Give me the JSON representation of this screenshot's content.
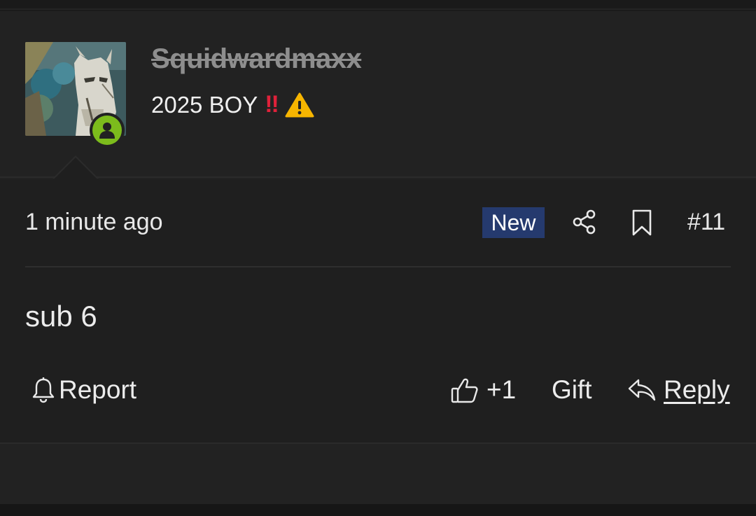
{
  "post": {
    "username": "Squidwardmaxx",
    "user_title": "2025 BOY",
    "user_title_emojis": [
      "double-exclamation",
      "warning-sign"
    ],
    "avatar": "horse-avatar",
    "online_status": "online",
    "timestamp": "1 minute ago",
    "new_badge": "New",
    "post_number": "#11",
    "content": "sub 6",
    "actions": {
      "report": "Report",
      "like_count": "+1",
      "gift": "Gift",
      "reply": "Reply"
    }
  },
  "colors": {
    "background": "#1f1f1f",
    "new_badge_bg": "#253a6e",
    "online_green": "#7cbc1c",
    "username_gray": "#8e8e8e"
  }
}
